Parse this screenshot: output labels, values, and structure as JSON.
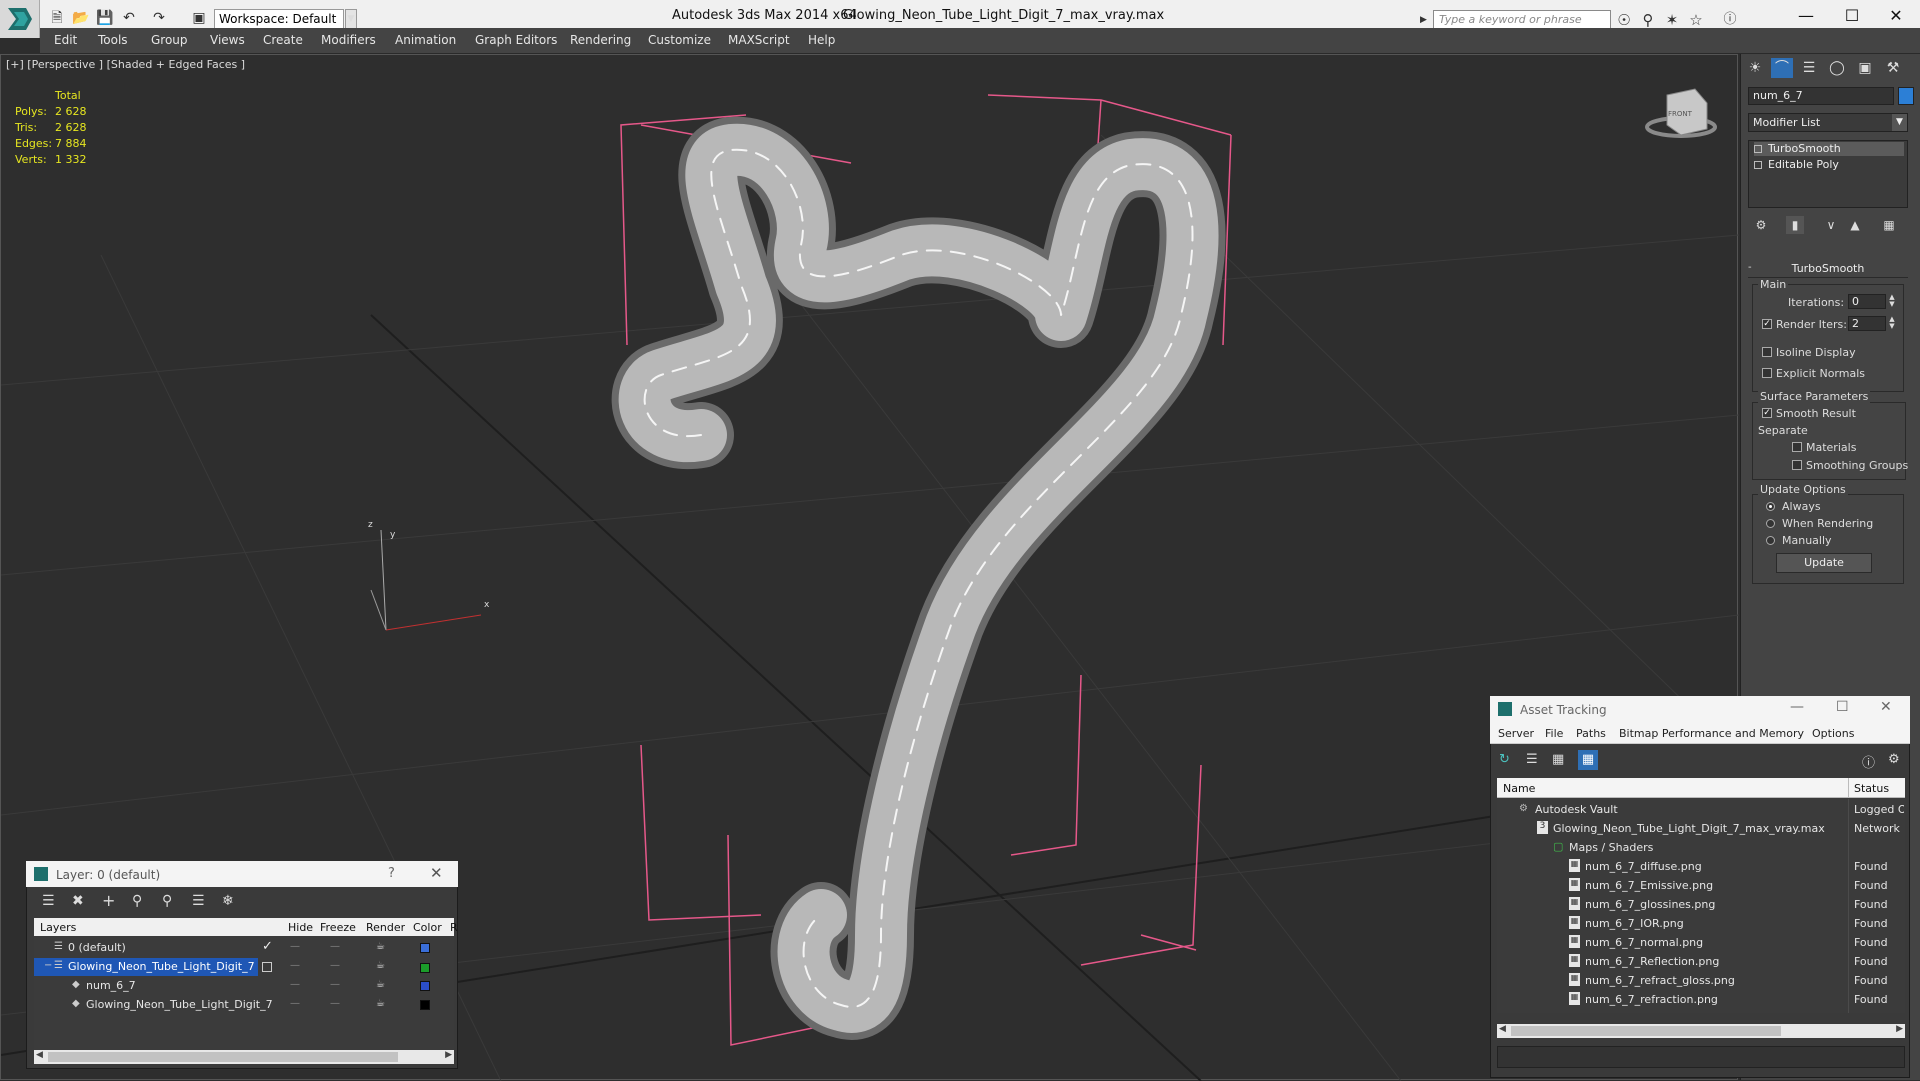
{
  "app": {
    "title": "Autodesk 3ds Max  2014 x64",
    "file": "Glowing_Neon_Tube_Light_Digit_7_max_vray.max",
    "workspace": "Workspace: Default",
    "search_placeholder": "Type a keyword or phrase",
    "window_controls": [
      "minimize-icon",
      "maximize-icon",
      "close-icon"
    ]
  },
  "menu": [
    "Edit",
    "Tools",
    "Group",
    "Views",
    "Create",
    "Modifiers",
    "Animation",
    "Graph Editors",
    "Rendering",
    "Customize",
    "MAXScript",
    "Help"
  ],
  "viewport": {
    "label": "[+] [Perspective ] [Shaded + Edged Faces ]",
    "stats": {
      "header": "Total",
      "rows": [
        {
          "label": "Polys:",
          "value": "2 628"
        },
        {
          "label": "Tris:",
          "value": "2 628"
        },
        {
          "label": "Edges:",
          "value": "7 884"
        },
        {
          "label": "Verts:",
          "value": "1 332"
        }
      ]
    },
    "gizmo": {
      "x": "x",
      "y": "y",
      "z": "z"
    },
    "viewcube_label": "FRONT"
  },
  "command_panel": {
    "object_name": "num_6_7",
    "object_color": "#2c7fd6",
    "modifier_list": "Modifier List",
    "stack": [
      "TurboSmooth",
      "Editable Poly"
    ],
    "rollout": "TurboSmooth",
    "main": {
      "title": "Main",
      "iterations_label": "Iterations:",
      "iterations": "0",
      "render_iters_label": "Render Iters:",
      "render_iters": "2",
      "render_iters_checked": true,
      "isoline": "Isoline Display",
      "explicit_normals": "Explicit Normals"
    },
    "surface": {
      "title": "Surface Parameters",
      "smooth_result": "Smooth Result",
      "separate": "Separate",
      "materials": "Materials",
      "smoothing_groups": "Smoothing Groups"
    },
    "update": {
      "title": "Update Options",
      "always": "Always",
      "when_rendering": "When Rendering",
      "manually": "Manually",
      "button": "Update"
    }
  },
  "layer_window": {
    "title": "Layer: 0 (default)",
    "help": "?",
    "columns": [
      "Layers",
      "Hide",
      "Freeze",
      "Render",
      "Color",
      "R"
    ],
    "rows": [
      {
        "name": "0 (default)",
        "color": "#3a6ed8",
        "selected": false
      },
      {
        "name": "Glowing_Neon_Tube_Light_Digit_7",
        "color": "#1b9c2a",
        "selected": true
      },
      {
        "name": "num_6_7",
        "color": "#2b4ec8",
        "selected": false
      },
      {
        "name": "Glowing_Neon_Tube_Light_Digit_7",
        "color": "#000000",
        "selected": false
      }
    ]
  },
  "asset_tracking": {
    "title": "Asset Tracking",
    "menu": [
      "Server",
      "File",
      "Paths",
      "Bitmap Performance and Memory",
      "Options"
    ],
    "columns": [
      "Name",
      "Status"
    ],
    "rows": [
      {
        "name": "Autodesk Vault",
        "status": "Logged O"
      },
      {
        "name": "Glowing_Neon_Tube_Light_Digit_7_max_vray.max",
        "status": "Network P"
      },
      {
        "name": "Maps / Shaders",
        "status": ""
      },
      {
        "name": "num_6_7_diffuse.png",
        "status": "Found"
      },
      {
        "name": "num_6_7_Emissive.png",
        "status": "Found"
      },
      {
        "name": "num_6_7_glossines.png",
        "status": "Found"
      },
      {
        "name": "num_6_7_IOR.png",
        "status": "Found"
      },
      {
        "name": "num_6_7_normal.png",
        "status": "Found"
      },
      {
        "name": "num_6_7_Reflection.png",
        "status": "Found"
      },
      {
        "name": "num_6_7_refract_gloss.png",
        "status": "Found"
      },
      {
        "name": "num_6_7_refraction.png",
        "status": "Found"
      }
    ]
  }
}
